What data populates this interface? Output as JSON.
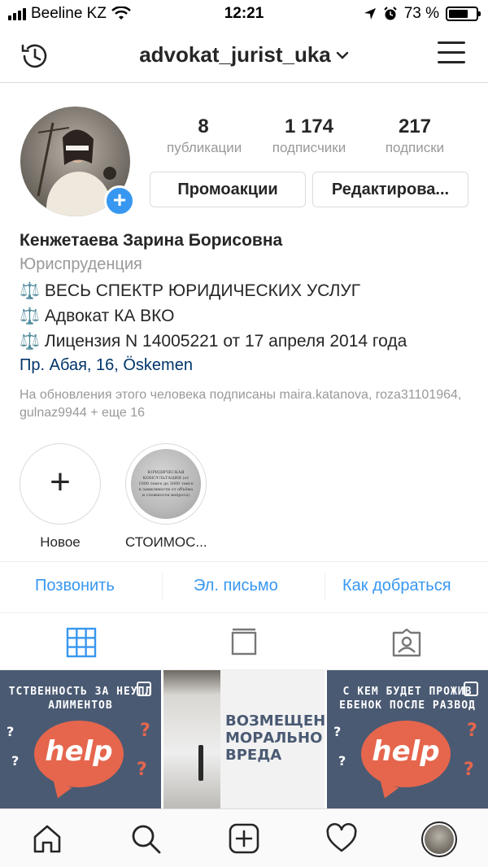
{
  "status_bar": {
    "carrier": "Beeline KZ",
    "time": "12:21",
    "battery": "73 %",
    "battery_level": 0.73
  },
  "nav": {
    "username": "advokat_jurist_uka"
  },
  "profile": {
    "stats": [
      {
        "value": "8",
        "label": "публикации"
      },
      {
        "value": "1 174",
        "label": "подписчики"
      },
      {
        "value": "217",
        "label": "подписки"
      }
    ],
    "promo_button": "Промоакции",
    "edit_button": "Редактирова..."
  },
  "bio": {
    "name": "Кенжетаева Зарина Борисовна",
    "category": "Юриспруденция",
    "scale_icon": "⚖️",
    "lines": [
      "ВЕСЬ СПЕКТР ЮРИДИЧЕСКИХ УСЛУГ",
      "Адвокат КА ВКО",
      "Лицензия N 14005221 от 17 апреля 2014 года"
    ],
    "address": "Пр. Абая, 16, Öskemen",
    "followed_by": "На обновления этого человека подписаны maira.katanova, roza31101964, gulnaz9944 + еще 16"
  },
  "highlights": [
    {
      "label": "Новое",
      "icon": "plus-icon"
    },
    {
      "label": "СТОИМОС...",
      "cover_text": "ЮРИДИЧЕСКАЯ КОНСУЛЬТАЦИЯ (от 1000 тенге до 3000 тенге в зависимости от объёма и сложности вопроса)"
    }
  ],
  "contacts": {
    "call": "Позвонить",
    "email": "Эл. письмо",
    "directions": "Как добраться"
  },
  "posts": [
    {
      "header_lines": [
        "ТСТВЕННОСТЬ ЗА НЕУПЛ",
        "АЛИМЕНТОВ"
      ],
      "bubble_text": "help",
      "q1": "?",
      "q2": "?",
      "q3": "?",
      "q4": "?"
    },
    {
      "text_lines": [
        "ВОЗМЕЩЕН",
        "МОРАЛЬНО",
        "ВРЕДА"
      ]
    },
    {
      "header_lines": [
        "С КЕМ БУДЕТ ПРОЖИВ",
        "ЕБЕНОК ПОСЛЕ РАЗВОД"
      ],
      "bubble_text": "help",
      "q1": "?",
      "q2": "?",
      "q3": "?",
      "q4": "?"
    }
  ],
  "colors": {
    "accent": "#3897f0",
    "link_dark": "#003569",
    "muted": "#999999",
    "tile_bg": "#4a5a73",
    "bubble": "#e5664d"
  }
}
